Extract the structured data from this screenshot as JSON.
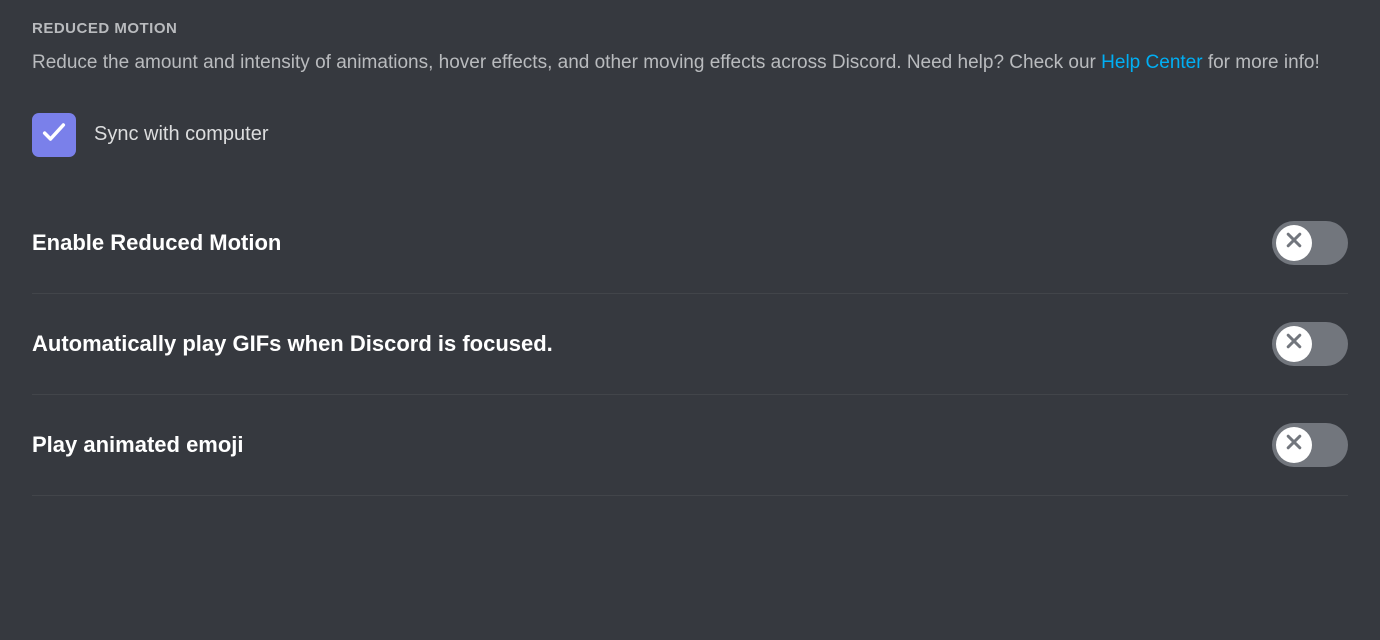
{
  "section": {
    "header": "REDUCED MOTION",
    "description_pre": "Reduce the amount and intensity of animations, hover effects, and other moving effects across Discord. Need help? Check our ",
    "description_link": "Help Center",
    "description_post": " for more info!"
  },
  "sync_checkbox": {
    "label": "Sync with computer",
    "checked": true
  },
  "settings": [
    {
      "label": "Enable Reduced Motion",
      "enabled": false
    },
    {
      "label": "Automatically play GIFs when Discord is focused.",
      "enabled": false
    },
    {
      "label": "Play animated emoji",
      "enabled": false
    }
  ]
}
